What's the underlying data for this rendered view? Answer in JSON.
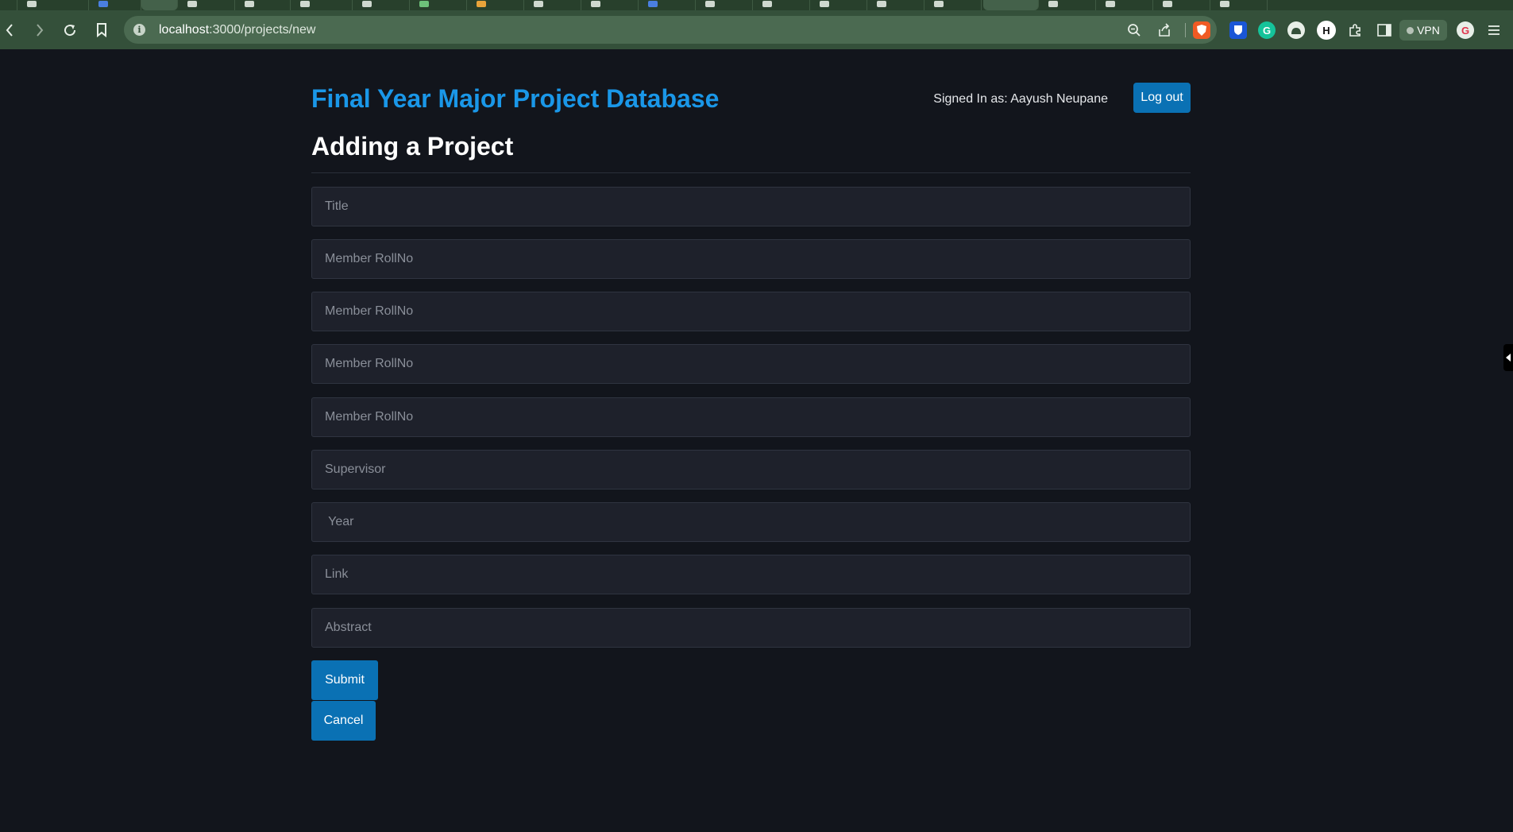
{
  "browser": {
    "url_host": "localhost",
    "url_path": ":3000/projects/new",
    "vpn_label": "VPN",
    "colors": {
      "frame": "#34503a",
      "omnibox": "#4b6a51"
    }
  },
  "header": {
    "site_title": "Final Year Major Project Database",
    "signed_in": "Signed In as: Aayush Neupane",
    "logout_label": "Log out"
  },
  "form": {
    "heading": "Adding a Project",
    "fields": [
      {
        "name": "title-input",
        "placeholder": "Title",
        "value": ""
      },
      {
        "name": "member-rollno-input-1",
        "placeholder": "Member RollNo",
        "value": ""
      },
      {
        "name": "member-rollno-input-2",
        "placeholder": "Member RollNo",
        "value": ""
      },
      {
        "name": "member-rollno-input-3",
        "placeholder": "Member RollNo",
        "value": ""
      },
      {
        "name": "member-rollno-input-4",
        "placeholder": "Member RollNo",
        "value": ""
      },
      {
        "name": "supervisor-input",
        "placeholder": "Supervisor",
        "value": ""
      },
      {
        "name": "year-input",
        "placeholder": " Year",
        "value": ""
      },
      {
        "name": "link-input",
        "placeholder": "Link",
        "value": ""
      },
      {
        "name": "abstract-input",
        "placeholder": "Abstract",
        "value": ""
      }
    ],
    "submit_label": "Submit",
    "cancel_label": "Cancel"
  },
  "theme": {
    "accent": "#0a71b4",
    "title_color": "#1a97e8",
    "background": "#12151c",
    "input_background": "#1e212b"
  }
}
